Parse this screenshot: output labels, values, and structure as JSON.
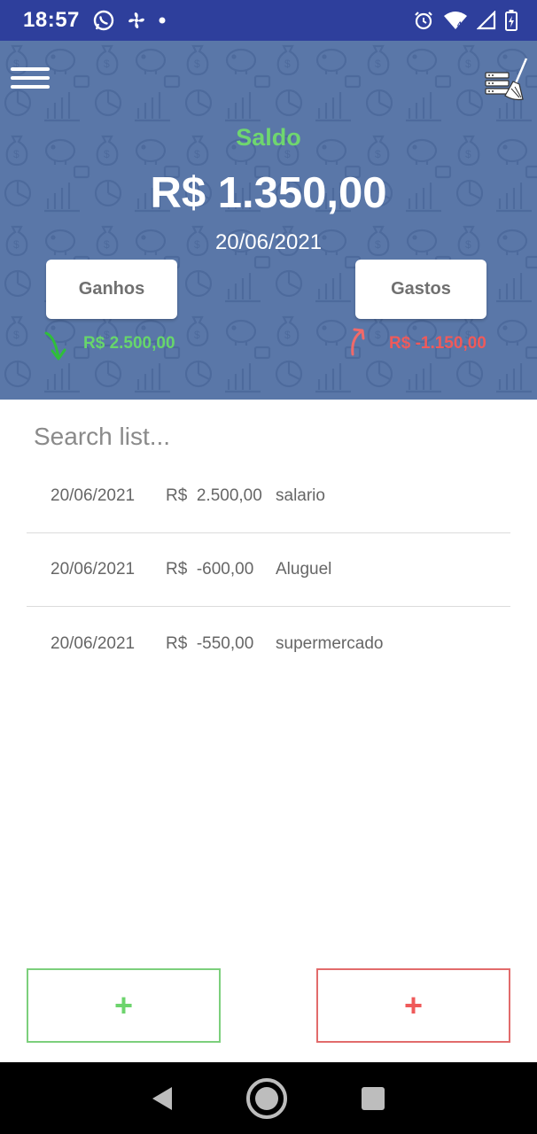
{
  "status_bar": {
    "time": "18:57",
    "icons": [
      "whatsapp-icon",
      "fan-icon",
      "dot-icon",
      "alarm-icon",
      "wifi-icon",
      "signal-icon",
      "battery-icon"
    ],
    "color": "#2e3f9c"
  },
  "header": {
    "background_color": "#5a77a8",
    "saldo_label": "Saldo",
    "saldo_amount": "R$ 1.350,00",
    "date": "20/06/2021",
    "ganhos_label": "Ganhos",
    "gastos_label": "Gastos",
    "ganhos_total": "R$ 2.500,00",
    "gastos_total": "R$ -1.150,00",
    "income_color": "#67d66b",
    "expense_color": "#ef5a5a"
  },
  "search": {
    "placeholder": "Search list..."
  },
  "transactions": [
    {
      "date": "20/06/2021",
      "amount": "R$  2.500,00",
      "description": "salario"
    },
    {
      "date": "20/06/2021",
      "amount": "R$  -600,00",
      "description": "Aluguel"
    },
    {
      "date": "20/06/2021",
      "amount": "R$  -550,00",
      "description": "supermercado"
    }
  ],
  "buttons": {
    "add_income_label": "+",
    "add_expense_label": "+"
  },
  "nav_bar": {
    "icons": [
      "back-icon",
      "home-icon",
      "recents-icon"
    ]
  }
}
